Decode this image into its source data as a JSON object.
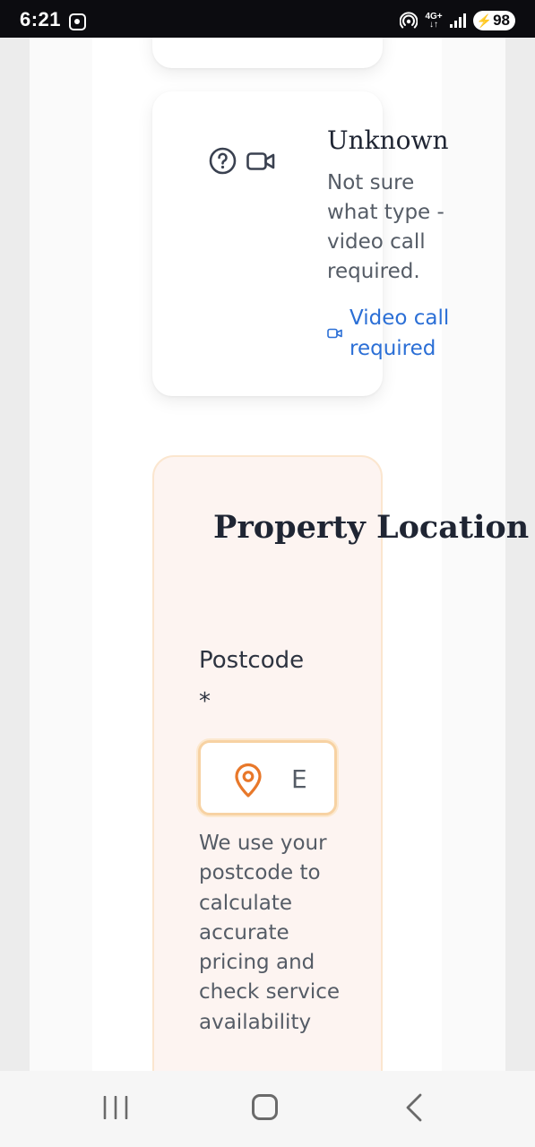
{
  "status_bar": {
    "time": "6:21",
    "network_type_top": "4G+",
    "network_type_bottom": "↓↑",
    "battery_level": "98",
    "icons": [
      "screenshot-icon",
      "hotspot-icon",
      "signal-icon",
      "battery-icon"
    ]
  },
  "service_option": {
    "title": "Unknown",
    "description": "Not sure what type - video call required.",
    "video_link_label": "Video call required",
    "icons": [
      "help-circle-icon",
      "video-camera-icon"
    ],
    "link_color": "#2b6fd6"
  },
  "property_location": {
    "title": "Property Location",
    "postcode_label": "Postcode",
    "required_marker": "*",
    "postcode_placeholder": "E",
    "postcode_value": "",
    "help_text": "We use your postcode to calculate accurate pricing and check service availability",
    "accent_color": "#e8782a",
    "background_color": "#fdf4f1"
  },
  "nav_bar": {
    "buttons": [
      "recent-apps-button",
      "home-button",
      "back-button"
    ]
  }
}
